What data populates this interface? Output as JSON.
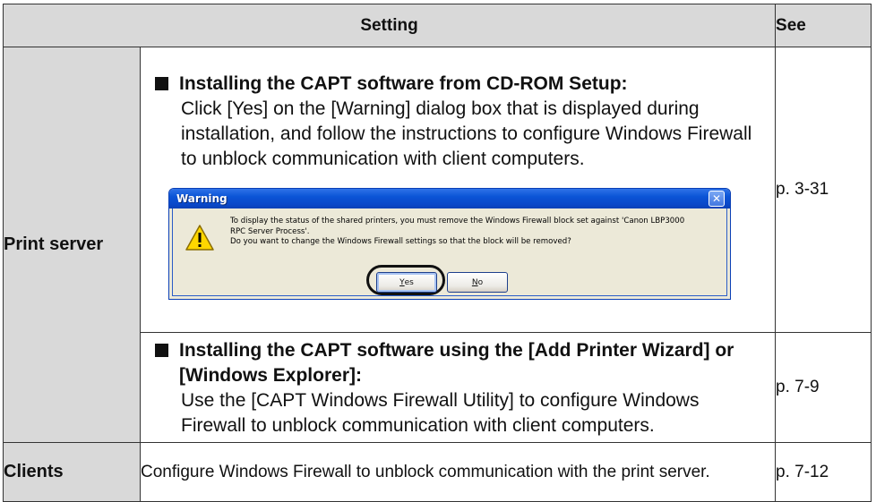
{
  "table": {
    "header": {
      "setting": "Setting",
      "see": "See"
    },
    "print_server": {
      "label": "Print server",
      "section1": {
        "title": "Installing the CAPT software from CD-ROM Setup:",
        "body": "Click [Yes] on the [Warning] dialog box that is displayed during installation, and follow the instructions to configure Windows Firewall to unblock communication with client computers.",
        "page": "p. 3-31"
      },
      "section2": {
        "title": "Installing the CAPT software using the [Add Printer Wizard] or [Windows Explorer]:",
        "body": "Use the [CAPT Windows Firewall Utility] to configure Windows Firewall to unblock communication with client computers.",
        "page": "p. 7-9"
      }
    },
    "clients": {
      "label": "Clients",
      "body": "Configure Windows Firewall to unblock communication with the print server.",
      "page": "p. 7-12"
    }
  },
  "dialog": {
    "title": "Warning",
    "close_glyph": "✕",
    "message_line1": "To display the status of the shared printers, you must remove the Windows Firewall block set against 'Canon LBP3000",
    "message_line2": "RPC Server Process'.",
    "message_line3": "Do you want to change the Windows Firewall settings so that the block will be removed?",
    "yes_mnemonic": "Y",
    "yes_rest": "es",
    "no_mnemonic": "N",
    "no_rest": "o",
    "icon": "warning-icon"
  }
}
